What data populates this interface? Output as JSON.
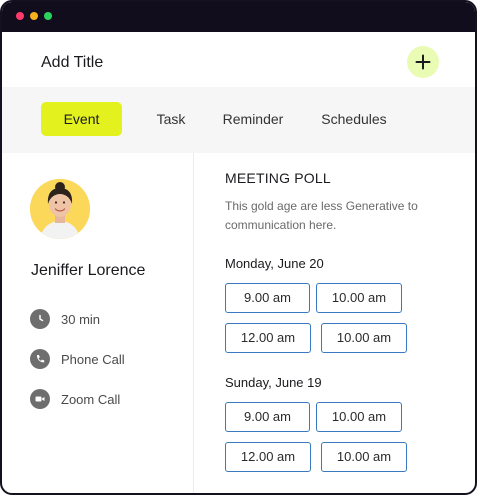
{
  "header": {
    "title": "Add Title"
  },
  "tabs": [
    {
      "label": "Event",
      "active": true
    },
    {
      "label": "Task",
      "active": false
    },
    {
      "label": "Reminder",
      "active": false
    },
    {
      "label": "Schedules",
      "active": false
    }
  ],
  "profile": {
    "name": "Jeniffer Lorence",
    "details": [
      {
        "icon": "clock-icon",
        "text": "30 min"
      },
      {
        "icon": "phone-icon",
        "text": "Phone Call"
      },
      {
        "icon": "video-icon",
        "text": "Zoom Call"
      }
    ]
  },
  "poll": {
    "title": "MEETING POLL",
    "description": "This gold age are less Generative to communication here.",
    "days": [
      {
        "label": "Monday, June 20",
        "slots": [
          "9.00 am",
          "10.00 am",
          "12.00 am",
          "10.00 am"
        ]
      },
      {
        "label": "Sunday, June 19",
        "slots": [
          "9.00 am",
          "10.00 am",
          "12.00 am",
          "10.00 am"
        ]
      }
    ]
  },
  "colors": {
    "accent": "#e3f21f",
    "add_button_bg": "#eafbb3",
    "slot_border": "#3a79c2",
    "titlebar": "#120d1c"
  }
}
